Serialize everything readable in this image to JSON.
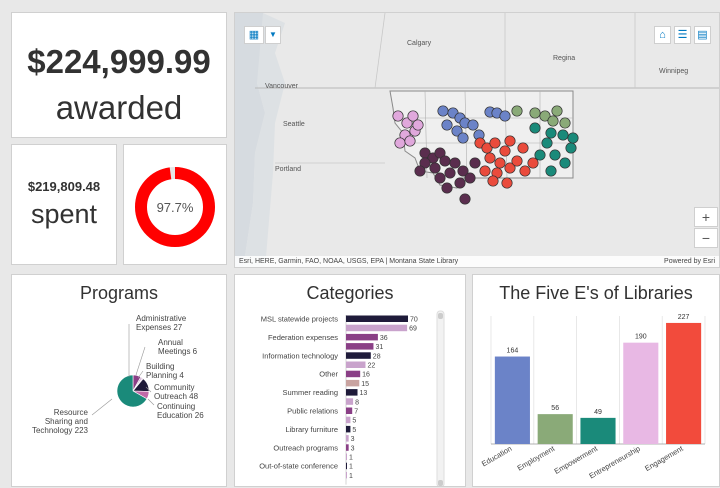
{
  "awarded": {
    "amount": "$224,999.99",
    "label": "awarded"
  },
  "spent": {
    "amount": "$219,809.48",
    "label": "spent"
  },
  "gauge": {
    "value_text": "97.7%",
    "fraction": 0.977,
    "color": "#ff0000",
    "track": "#e6e6e6"
  },
  "map": {
    "labels": [
      "Calgary",
      "Regina",
      "Winnipeg",
      "Vancouver",
      "Seattle",
      "Portland"
    ],
    "attribution": "Esri, HERE, Garmin, FAO, NOAA, USGS, EPA | Montana State Library",
    "powered_by": "Powered by Esri",
    "zoom_in": "+",
    "zoom_out": "−",
    "colors": {
      "education": "#6b83c8",
      "employment": "#8aaa78",
      "empowerment": "#1a8a7a",
      "entrepreneurship": "#e0a8dc",
      "engagement": "#ea4b3c",
      "other": "#5a2d4e"
    }
  },
  "programs": {
    "title": "Programs",
    "labels": [
      {
        "lines": [
          "Administrative",
          "Expenses 27"
        ]
      },
      {
        "lines": [
          "Annual",
          "Meetings 6"
        ]
      },
      {
        "lines": [
          "Building",
          "Planning 4"
        ]
      },
      {
        "lines": [
          "Community",
          "Outreach 48"
        ]
      },
      {
        "lines": [
          "Continuing",
          "Education 26"
        ]
      },
      {
        "lines": [
          "Resource",
          "Sharing and",
          "Technology 223"
        ]
      }
    ]
  },
  "categories": {
    "title": "Categories",
    "rows": [
      {
        "label": "MSL statewide projects",
        "value": 70,
        "color": "#1f1b3a"
      },
      {
        "label": "",
        "value": 69,
        "color": "#c9a3cc"
      },
      {
        "label": "Federation expenses",
        "value": 36,
        "color": "#8a3f86"
      },
      {
        "label": "",
        "value": 31,
        "color": "#8a3f86"
      },
      {
        "label": "Information technology",
        "value": 28,
        "color": "#1f1b3a"
      },
      {
        "label": "",
        "value": 22,
        "color": "#c9a3cc"
      },
      {
        "label": "Other",
        "value": 16,
        "color": "#8a3f86"
      },
      {
        "label": "",
        "value": 15,
        "color": "#c9a3a0"
      },
      {
        "label": "Summer reading",
        "value": 13,
        "color": "#1f1b3a"
      },
      {
        "label": "",
        "value": 8,
        "color": "#c9a3cc"
      },
      {
        "label": "Public relations",
        "value": 7,
        "color": "#8a3f86"
      },
      {
        "label": "",
        "value": 5,
        "color": "#c9a3cc"
      },
      {
        "label": "Library furniture",
        "value": 5,
        "color": "#1f1b3a"
      },
      {
        "label": "",
        "value": 3,
        "color": "#c9a3cc"
      },
      {
        "label": "Outreach programs",
        "value": 3,
        "color": "#8a3f86"
      },
      {
        "label": "",
        "value": 1,
        "color": "#c9a3cc"
      },
      {
        "label": "Out-of-state conference",
        "value": 1,
        "color": "#1f1b3a"
      },
      {
        "label": "",
        "value": 1,
        "color": "#c9a3cc"
      }
    ]
  },
  "chart_data": {
    "type": "bar",
    "title": "The Five E's of Libraries",
    "categories": [
      "Education",
      "Employment",
      "Empowerment",
      "Entrepreneurship",
      "Engagement"
    ],
    "values": [
      164,
      56,
      49,
      190,
      227
    ],
    "colors": [
      "#6b83c8",
      "#8aaa78",
      "#1a8a7a",
      "#e8b8e4",
      "#f24b3c"
    ],
    "ylim": [
      0,
      240
    ],
    "xlabel": "",
    "ylabel": ""
  }
}
